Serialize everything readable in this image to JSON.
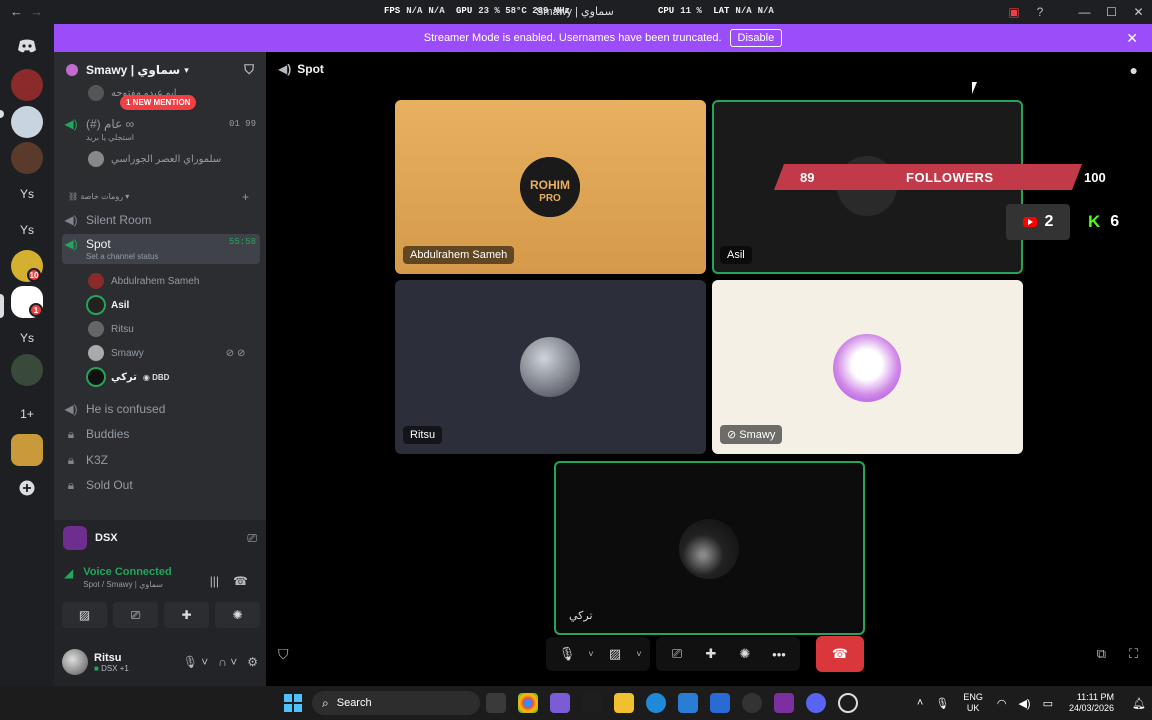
{
  "titlebar": {
    "window_title": "Smawy | سماوي",
    "perf": {
      "fps_label": "FPS",
      "fps_value": "N/A",
      "fps_extra": "N/A",
      "gpu_label": "GPU",
      "gpu_value": "23 % 58°C 289 MHz",
      "cpu_label": "CPU",
      "cpu_value": "11 %",
      "lat_label": "LAT",
      "lat_value": "N/A",
      "lat_extra": "N/A"
    }
  },
  "banner": {
    "text": "Streamer Mode is enabled. Usernames have been truncated.",
    "disable_label": "Disable"
  },
  "rail": {
    "servers": [
      {
        "label": "",
        "color": "#5865f2"
      },
      {
        "label": "",
        "color": "#8b2a2a"
      },
      {
        "label": "",
        "color": "#c8d4df"
      },
      {
        "label": "",
        "color": "#5a3a2a"
      },
      {
        "label": "Ys",
        "color": "#1e1f22"
      },
      {
        "label": "Ys",
        "color": "#1e1f22"
      },
      {
        "label": "",
        "color": "#d4b030"
      },
      {
        "label": "",
        "color": "#ffffff"
      },
      {
        "label": "Ys",
        "color": "#1e1f22"
      },
      {
        "label": "",
        "color": "#3a4a3a"
      },
      {
        "label": "1+",
        "color": "#1e1f22"
      },
      {
        "label": "",
        "color": "#c89a3a"
      },
      {
        "label": "+",
        "color": "#1e1f22"
      }
    ],
    "badge_10": "10",
    "badge_1": "1"
  },
  "sidebar": {
    "server_name": "Smawy | سماوي",
    "mention_pill": "1 NEW MENTION",
    "top_member": "ابو عبدو مفتوحه",
    "voice_channel_1": "(#) عام ∞",
    "voice_channel_1_sub": "استجلي يا بريد",
    "voice_channel_1_counts": "01   99",
    "stream_member": "سلموراي العصر الجوراسي",
    "category": "رومات خاصة",
    "channels": [
      {
        "name": "Silent Room",
        "icon": "speaker"
      },
      {
        "name": "Spot",
        "icon": "speaker",
        "active": true,
        "status": "Set a channel status",
        "time": "55:58"
      }
    ],
    "members": [
      {
        "name": "Abdulrahem Sameh"
      },
      {
        "name": "Asil"
      },
      {
        "name": "Ritsu"
      },
      {
        "name": "Smawy"
      },
      {
        "name": "تركي",
        "activity": "DBD"
      }
    ],
    "more_channels": [
      {
        "name": "He is confused",
        "icon": "speaker"
      },
      {
        "name": "Buddies",
        "icon": "lock"
      },
      {
        "name": "K3Z",
        "icon": "lock"
      },
      {
        "name": "Sold Out",
        "icon": "lock"
      }
    ]
  },
  "activity": {
    "name": "DSX"
  },
  "voice": {
    "title": "Voice Connected",
    "subtitle": "Spot / Smawy | سماوي"
  },
  "user": {
    "name": "Ritsu",
    "status": "DSX +1"
  },
  "call": {
    "channel_name": "Spot",
    "tiles": [
      {
        "name": "Abdulrahem Sameh"
      },
      {
        "name": "Asil"
      },
      {
        "name": "Ritsu"
      },
      {
        "name": "Smawy"
      },
      {
        "name": "تركي"
      }
    ],
    "overlay": {
      "followers_current": "89",
      "followers_label": "FOLLOWERS",
      "followers_goal": "100",
      "followers_progress": 0.89,
      "youtube_count": "2",
      "kick_count": "6"
    }
  },
  "taskbar": {
    "search_label": "Search",
    "lang_top": "ENG",
    "lang_bottom": "UK",
    "time": "11:11 PM",
    "date": "24/03/2026"
  }
}
